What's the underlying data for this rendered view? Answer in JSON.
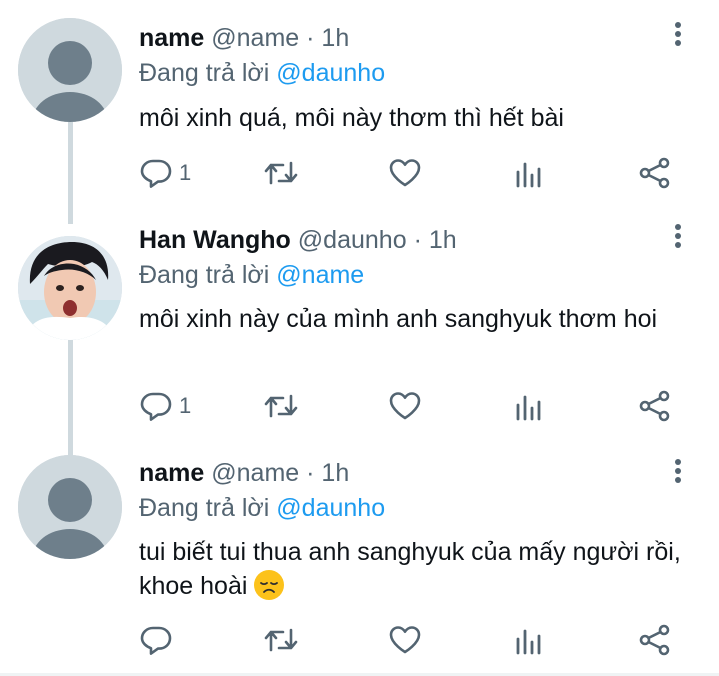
{
  "tweets": [
    {
      "name": "name",
      "handle": "@name",
      "separator": "·",
      "time": "1h",
      "reply_prefix": "Đang trả lời",
      "reply_to": "@daunho",
      "text": "môi xinh quá, môi này thơm thì hết bài",
      "reply_count": "1",
      "avatar": "default-avatar"
    },
    {
      "name": "Han Wangho",
      "handle": "@daunho",
      "separator": "·",
      "time": "1h",
      "reply_prefix": "Đang trả lời",
      "reply_to": "@name",
      "text": "môi xinh này của mình anh sanghyuk thơm hoi",
      "reply_count": "1",
      "avatar": "photo-avatar"
    },
    {
      "name": "name",
      "handle": "@name",
      "separator": "·",
      "time": "1h",
      "reply_prefix": "Đang trả lời",
      "reply_to": "@daunho",
      "text": "tui biết tui thua anh sanghyuk của mấy người rồi, khoe hoài",
      "reply_count": "",
      "avatar": "default-avatar",
      "emoji": "disappointed-face"
    }
  ],
  "icons": {
    "reply": "reply-icon",
    "retweet": "retweet-icon",
    "like": "like-icon",
    "stats": "stats-icon",
    "share": "share-icon",
    "more": "more-icon"
  },
  "colors": {
    "accent": "#1d9bf0",
    "secondary_text": "#536471",
    "primary_text": "#0f1419",
    "thread_line": "#cfd9de"
  }
}
